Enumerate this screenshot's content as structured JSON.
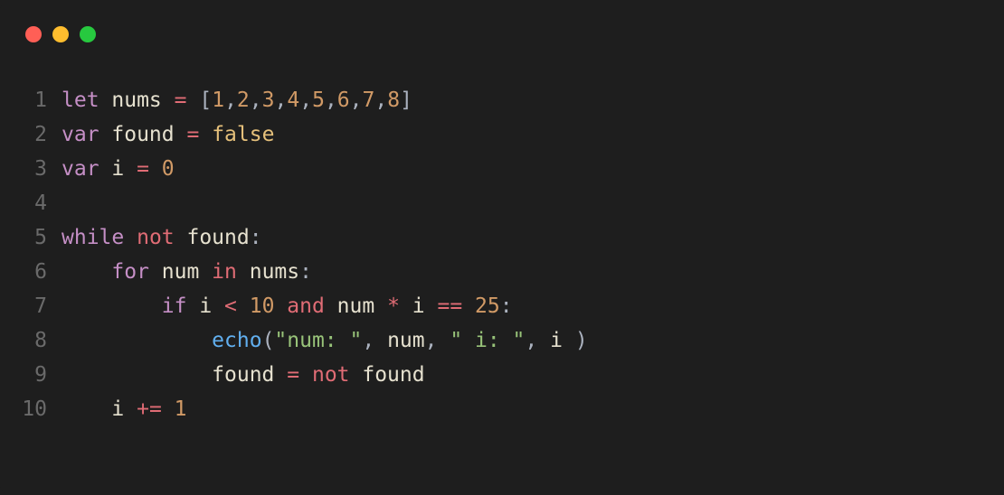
{
  "window": {
    "traffic_lights": {
      "red": "#ff5f56",
      "yellow": "#ffbd2e",
      "green": "#27c93f"
    }
  },
  "editor": {
    "line_numbers": [
      "1",
      "2",
      "3",
      "4",
      "5",
      "6",
      "7",
      "8",
      "9",
      "10"
    ],
    "lines": [
      {
        "indent": "",
        "tokens": [
          {
            "t": "let ",
            "c": "tok-kw"
          },
          {
            "t": "nums ",
            "c": "tok-ident"
          },
          {
            "t": "= ",
            "c": "tok-op"
          },
          {
            "t": "[",
            "c": "tok-punct"
          },
          {
            "t": "1",
            "c": "tok-num"
          },
          {
            "t": ",",
            "c": "tok-punct"
          },
          {
            "t": "2",
            "c": "tok-num"
          },
          {
            "t": ",",
            "c": "tok-punct"
          },
          {
            "t": "3",
            "c": "tok-num"
          },
          {
            "t": ",",
            "c": "tok-punct"
          },
          {
            "t": "4",
            "c": "tok-num"
          },
          {
            "t": ",",
            "c": "tok-punct"
          },
          {
            "t": "5",
            "c": "tok-num"
          },
          {
            "t": ",",
            "c": "tok-punct"
          },
          {
            "t": "6",
            "c": "tok-num"
          },
          {
            "t": ",",
            "c": "tok-punct"
          },
          {
            "t": "7",
            "c": "tok-num"
          },
          {
            "t": ",",
            "c": "tok-punct"
          },
          {
            "t": "8",
            "c": "tok-num"
          },
          {
            "t": "]",
            "c": "tok-punct"
          }
        ]
      },
      {
        "indent": "",
        "tokens": [
          {
            "t": "var ",
            "c": "tok-kw"
          },
          {
            "t": "found ",
            "c": "tok-ident"
          },
          {
            "t": "= ",
            "c": "tok-op"
          },
          {
            "t": "false",
            "c": "tok-bool"
          }
        ]
      },
      {
        "indent": "",
        "tokens": [
          {
            "t": "var ",
            "c": "tok-kw"
          },
          {
            "t": "i ",
            "c": "tok-ident"
          },
          {
            "t": "= ",
            "c": "tok-op"
          },
          {
            "t": "0",
            "c": "tok-num"
          }
        ]
      },
      {
        "indent": "",
        "tokens": []
      },
      {
        "indent": "",
        "tokens": [
          {
            "t": "while ",
            "c": "tok-kw"
          },
          {
            "t": "not ",
            "c": "tok-op"
          },
          {
            "t": "found",
            "c": "tok-ident"
          },
          {
            "t": ":",
            "c": "tok-punct"
          }
        ]
      },
      {
        "indent": "    ",
        "tokens": [
          {
            "t": "for ",
            "c": "tok-kw"
          },
          {
            "t": "num ",
            "c": "tok-ident"
          },
          {
            "t": "in ",
            "c": "tok-op"
          },
          {
            "t": "nums",
            "c": "tok-ident"
          },
          {
            "t": ":",
            "c": "tok-punct"
          }
        ]
      },
      {
        "indent": "        ",
        "tokens": [
          {
            "t": "if ",
            "c": "tok-kw"
          },
          {
            "t": "i ",
            "c": "tok-ident"
          },
          {
            "t": "< ",
            "c": "tok-op"
          },
          {
            "t": "10 ",
            "c": "tok-num"
          },
          {
            "t": "and ",
            "c": "tok-op"
          },
          {
            "t": "num ",
            "c": "tok-ident"
          },
          {
            "t": "* ",
            "c": "tok-op"
          },
          {
            "t": "i ",
            "c": "tok-ident"
          },
          {
            "t": "== ",
            "c": "tok-op"
          },
          {
            "t": "25",
            "c": "tok-num"
          },
          {
            "t": ":",
            "c": "tok-punct"
          }
        ]
      },
      {
        "indent": "            ",
        "tokens": [
          {
            "t": "echo",
            "c": "tok-func"
          },
          {
            "t": "(",
            "c": "tok-punct"
          },
          {
            "t": "\"num: \"",
            "c": "tok-str"
          },
          {
            "t": ", ",
            "c": "tok-punct"
          },
          {
            "t": "num",
            "c": "tok-ident"
          },
          {
            "t": ", ",
            "c": "tok-punct"
          },
          {
            "t": "\" i: \"",
            "c": "tok-str"
          },
          {
            "t": ", ",
            "c": "tok-punct"
          },
          {
            "t": "i ",
            "c": "tok-ident"
          },
          {
            "t": ")",
            "c": "tok-punct"
          }
        ]
      },
      {
        "indent": "            ",
        "tokens": [
          {
            "t": "found ",
            "c": "tok-ident"
          },
          {
            "t": "= ",
            "c": "tok-op"
          },
          {
            "t": "not ",
            "c": "tok-op"
          },
          {
            "t": "found",
            "c": "tok-ident"
          }
        ]
      },
      {
        "indent": "    ",
        "tokens": [
          {
            "t": "i ",
            "c": "tok-ident"
          },
          {
            "t": "+= ",
            "c": "tok-op"
          },
          {
            "t": "1",
            "c": "tok-num"
          }
        ]
      }
    ]
  }
}
